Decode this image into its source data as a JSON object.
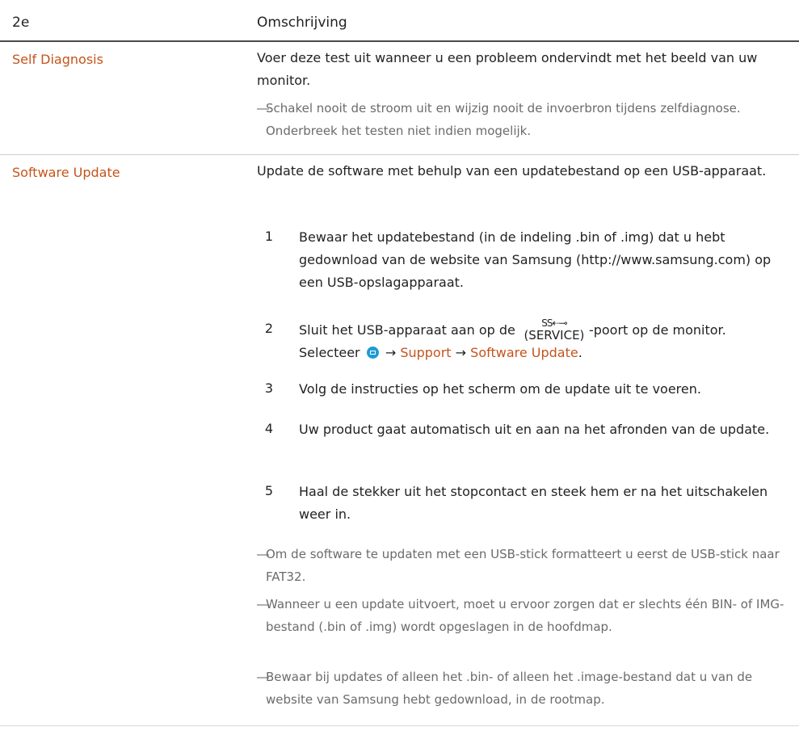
{
  "table": {
    "header": {
      "col1": "2e",
      "col2": "Omschrijving"
    },
    "rows": [
      {
        "label": "Self Diagnosis",
        "description": "Voer deze test uit wanneer u een probleem ondervindt met het beeld van uw monitor.",
        "notes": [
          "Schakel nooit de stroom uit en wijzig nooit de invoerbron tijdens zelfdiagnose. Onderbreek het testen niet indien mogelijk."
        ]
      },
      {
        "label": "Software Update",
        "description": "Update de software met behulp van een updatebestand op een USB-apparaat.",
        "steps": [
          {
            "num": "1",
            "text": "Bewaar het updatebestand (in de indeling .bin of .img) dat u hebt gedownload van de website van Samsung (http://www.samsung.com) op een USB-opslagapparaat."
          },
          {
            "num": "2",
            "text_before_port": "Sluit het USB-apparaat aan op de",
            "port_top": "SS⇠⊸",
            "port_label": "(SERVICE)",
            "text_after_port": "-poort op de monitor.",
            "select_prefix": "Selecteer",
            "arrow1": "→",
            "menu_support": "Support",
            "arrow2": "→",
            "menu_software_update": "Software Update",
            "end_period": "."
          },
          {
            "num": "3",
            "text": "Volg de instructies op het scherm om de update uit te voeren."
          },
          {
            "num": "4",
            "text": "Uw product gaat automatisch uit en aan na het afronden van de update."
          },
          {
            "num": "5",
            "text": "Haal de stekker uit het stopcontact en steek hem er na het uitschakelen weer in."
          }
        ],
        "notes": [
          "Om de software te updaten met een USB-stick formatteert u eerst de USB-stick naar FAT32.",
          "Wanneer u een update uitvoert, moet u ervoor zorgen dat er slechts één BIN- of IMG-bestand (.bin of .img) wordt opgeslagen in de hoofdmap.",
          "Bewaar bij updates of alleen het .bin- of alleen het .image-bestand dat u van de website van Samsung hebt gedownload, in de rootmap."
        ]
      }
    ],
    "note_dash": "―",
    "icons": {
      "menu_icon": "menu-button-icon",
      "usb_icon": "usb-superspeed-icon"
    },
    "colors": {
      "accent": "#c4541c",
      "note_text": "#6b6b6b",
      "body_text": "#222222",
      "menu_icon_fill": "#1e9bd6"
    }
  }
}
